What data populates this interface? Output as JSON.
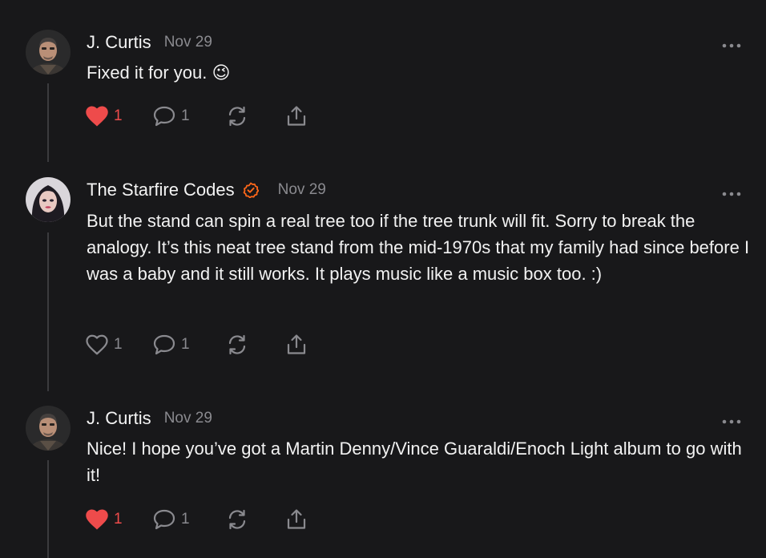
{
  "colors": {
    "background": "#18181a",
    "text": "#f2f2f2",
    "muted": "#8a8a8f",
    "liked": "#ee4b4b",
    "verified": "#ff6719",
    "thread_line": "#3b3b3e"
  },
  "comments": [
    {
      "author": "J. Curtis",
      "date": "Nov 29",
      "verified": false,
      "body": "Fixed it for you. 😉",
      "likes": "1",
      "liked": true,
      "replies": "1",
      "avatar_icon": "avatar-j-curtis"
    },
    {
      "author": "The Starfire Codes",
      "date": "Nov 29",
      "verified": true,
      "body": "But the stand can spin a real tree too if the tree trunk will fit. Sorry to break the analogy. It’s this neat tree stand from the mid-1970s that my family had since before I was a baby and it still works. It plays music like a music box too. :)",
      "likes": "1",
      "liked": false,
      "replies": "1",
      "avatar_icon": "avatar-starfire-codes"
    },
    {
      "author": "J. Curtis",
      "date": "Nov 29",
      "verified": false,
      "body": "Nice! I hope you’ve got a Martin Denny/Vince Guaraldi/Enoch Light album to go with it!",
      "likes": "1",
      "liked": true,
      "replies": "1",
      "avatar_icon": "avatar-j-curtis"
    }
  ],
  "icons": {
    "like": "heart-icon",
    "reply": "comment-bubble-icon",
    "restack": "restack-icon",
    "share": "share-icon",
    "more": "more-options-icon",
    "verified": "verified-badge-icon"
  }
}
